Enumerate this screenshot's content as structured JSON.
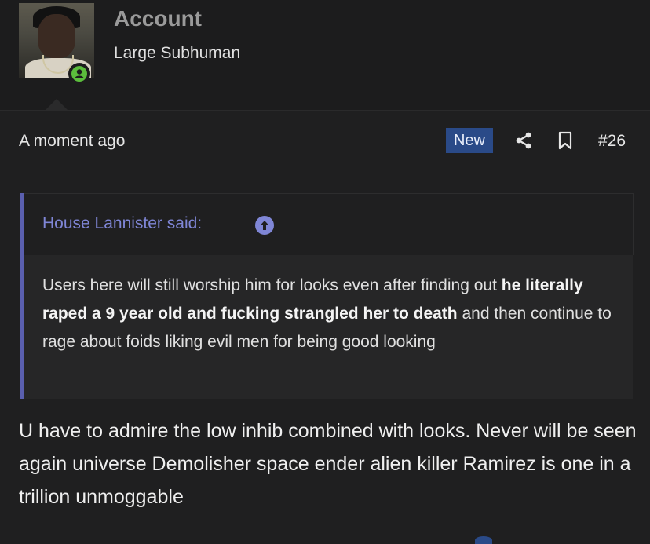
{
  "user": {
    "name": "Account",
    "title": "Large Subhuman",
    "status_color": "#5bbd3c"
  },
  "post": {
    "time": "A moment ago",
    "badge": "New",
    "number": "#26",
    "icons": [
      "share-icon",
      "bookmark-icon"
    ]
  },
  "quote": {
    "author": "House Lannister said:",
    "text_part1": "Users here will still worship him for looks even after finding out ",
    "text_bold": "he literally raped a 9 year old and fucking strangled her to death",
    "text_part2": " and then continue to rage about foids liking evil men for being good looking"
  },
  "body": {
    "text": "U have to admire the low inhib combined with looks. Never will be seen again universe Demolisher space ender alien killer Ramirez is one in a trillion unmoggable"
  },
  "colors": {
    "accent": "#7f86d6",
    "badge_bg": "#2a4a88",
    "background": "#1f1f20"
  }
}
